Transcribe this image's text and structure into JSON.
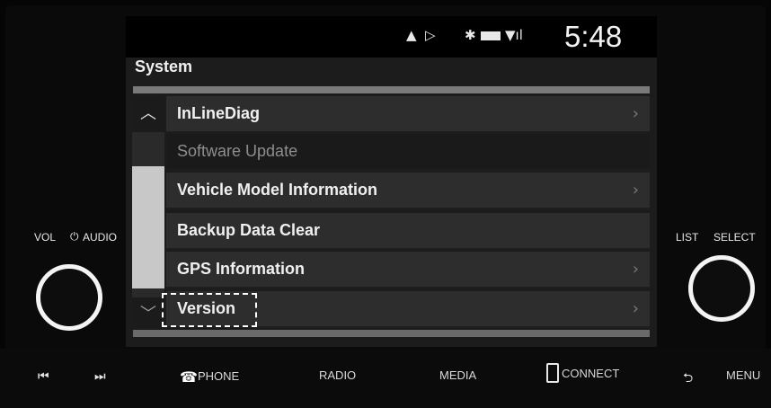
{
  "status": {
    "clock": "5:48",
    "icons": [
      "navigation-icon",
      "play-icon",
      "bluetooth-icon",
      "battery-icon",
      "signal-icon"
    ]
  },
  "screen": {
    "title": "System"
  },
  "menu": {
    "items": [
      {
        "label": "InLineDiag",
        "enabled": true,
        "has_arrow": true
      },
      {
        "label": "Software Update",
        "enabled": false,
        "has_arrow": false
      },
      {
        "label": "Vehicle Model Information",
        "enabled": true,
        "has_arrow": true
      },
      {
        "label": "Backup Data Clear",
        "enabled": true,
        "has_arrow": false
      },
      {
        "label": "GPS Information",
        "enabled": true,
        "has_arrow": true
      },
      {
        "label": "Version",
        "enabled": true,
        "has_arrow": true,
        "focused": true
      }
    ]
  },
  "knobs": {
    "left": {
      "vol": "VOL",
      "audio": "AUDIO"
    },
    "right": {
      "list": "LIST",
      "select": "SELECT"
    }
  },
  "bottom_bar": {
    "phone": "PHONE",
    "radio": "RADIO",
    "media": "MEDIA",
    "connect": "CONNECT",
    "menu": "MENU"
  },
  "colors": {
    "row_bg": "#2d2d2d",
    "disabled_bg": "#1a1a1a",
    "scroll_thumb": "#c8c8c8",
    "knob_ring": "#f4f4f4"
  }
}
